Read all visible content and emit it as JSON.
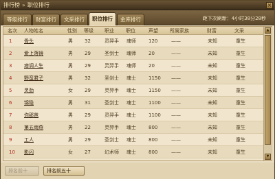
{
  "window": {
    "title": "排行榜",
    "separator": "»",
    "subtitle": "职位排行",
    "close_label": "×"
  },
  "tabs": [
    {
      "label": "等级排行",
      "active": false
    },
    {
      "label": "财富排行",
      "active": false
    },
    {
      "label": "文采排行",
      "active": false
    },
    {
      "label": "职位排行",
      "active": true
    },
    {
      "label": "金库排行",
      "active": false
    }
  ],
  "refresh_text": "距下次刷新：4小时38分28秒",
  "table": {
    "columns": [
      "名次",
      "人物姓名",
      "性别",
      "等级",
      "职业",
      "职位",
      "声望",
      "所属家族",
      "财富",
      "文采"
    ],
    "rows": [
      [
        "1",
        "骨头",
        "男",
        "32",
        "灵羿手",
        "魂师",
        "120",
        "——",
        "未知",
        "童生"
      ],
      [
        "2",
        "爱上落镜",
        "男",
        "29",
        "圣剑士",
        "魂师",
        "20",
        "——",
        "未知",
        "童生"
      ],
      [
        "3",
        "痞调人生",
        "男",
        "29",
        "灵羿手",
        "魂师",
        "20",
        "——",
        "未知",
        "童生"
      ],
      [
        "4",
        "野蛮君子",
        "男",
        "32",
        "圣剑士",
        "魂士",
        "1150",
        "——",
        "未知",
        "童生"
      ],
      [
        "5",
        "灵劲",
        "女",
        "29",
        "灵羿手",
        "魂士",
        "1150",
        "——",
        "未知",
        "童生"
      ],
      [
        "6",
        "锦隐",
        "男",
        "31",
        "圣剑士",
        "魂士",
        "1100",
        "——",
        "未知",
        "童生"
      ],
      [
        "7",
        "你那爸",
        "男",
        "29",
        "灵羿手",
        "魂士",
        "1100",
        "——",
        "未知",
        "童生"
      ],
      [
        "8",
        "第五雨燕",
        "男",
        "22",
        "灵羿手",
        "魂士",
        "800",
        "——",
        "未知",
        "童生"
      ],
      [
        "9",
        "工人",
        "男",
        "29",
        "圣剑士",
        "魂士",
        "800",
        "——",
        "未知",
        "童生"
      ],
      [
        "10",
        "影闪",
        "女",
        "27",
        "幻术师",
        "魂士",
        "800",
        "——",
        "未知",
        "童生"
      ]
    ]
  },
  "scrollbar": {
    "up_icon": "▲",
    "down_icon": "▼"
  },
  "footer": {
    "prev_label": "排名前十",
    "next_label": "排名前五十"
  }
}
